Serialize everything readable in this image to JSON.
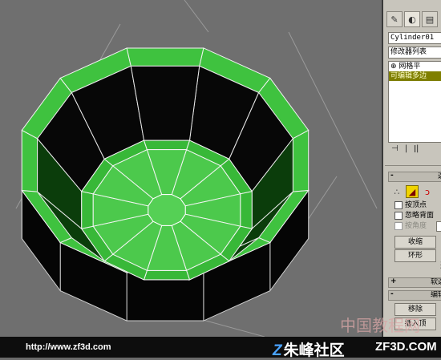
{
  "viewport": {
    "object": "cylinder-mesh"
  },
  "panel": {
    "tabs": [
      "create-icon",
      "modify-icon",
      "hierarchy-icon"
    ],
    "object_name": "Cylinder01",
    "modifier_list": "修改器列表",
    "stack": [
      {
        "label": "⊕ 网格平",
        "selected": false
      },
      {
        "label": "可编辑多边",
        "selected": true
      }
    ],
    "stack_tools": [
      "⊣",
      "|",
      "ǀ|"
    ],
    "selection_rollout": {
      "title": "选",
      "prefix": "-"
    },
    "checkboxes": [
      {
        "label": "按顶点",
        "enabled": true
      },
      {
        "label": "忽略背面",
        "enabled": true
      },
      {
        "label": "按角度",
        "enabled": false
      }
    ],
    "buttons": {
      "shrink": "收缩",
      "ring": "环形",
      "select_all": "选"
    },
    "soft_selection": {
      "title": "软选",
      "prefix": "+"
    },
    "edit_rollout": {
      "title": "编辑",
      "prefix": "-"
    },
    "remove_button": "移除",
    "insert_button": "插入顶"
  },
  "footer": {
    "url": "http://www.zf3d.com",
    "community": "朱峰社区",
    "site": "ZF3D.COM"
  },
  "watermark": "中国教程网"
}
